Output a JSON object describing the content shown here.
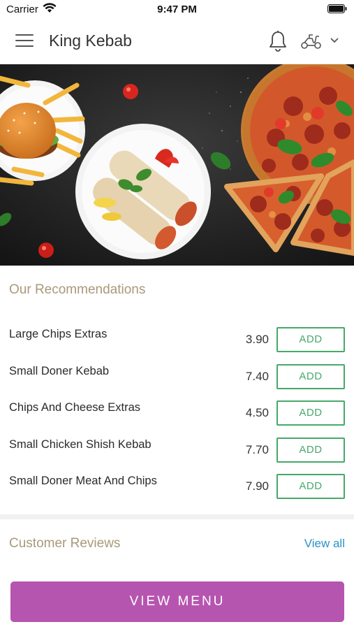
{
  "status_bar": {
    "carrier": "Carrier",
    "time": "9:47 PM"
  },
  "header": {
    "title": "King Kebab",
    "icons": [
      "menu-icon",
      "bell-icon",
      "delivery-scooter-icon",
      "chevron-down-icon"
    ]
  },
  "hero": {
    "description_icon": "food-banner-image"
  },
  "recommendations": {
    "title": "Our Recommendations",
    "add_label": "ADD",
    "items": [
      {
        "name": "Large Chips Extras",
        "price": "3.90"
      },
      {
        "name": "Small Doner Kebab",
        "price": "7.40"
      },
      {
        "name": "Chips And Cheese Extras",
        "price": "4.50"
      },
      {
        "name": "Small Chicken Shish Kebab",
        "price": "7.70"
      },
      {
        "name": "Small Doner Meat And Chips",
        "price": "7.90"
      }
    ]
  },
  "reviews": {
    "title": "Customer Reviews",
    "view_all": "View all"
  },
  "footer": {
    "view_menu": "VIEW MENU"
  },
  "colors": {
    "accent": "#b655b0",
    "add_green": "#46a96a",
    "section_title": "#a89a78",
    "link_blue": "#2b93c4"
  }
}
